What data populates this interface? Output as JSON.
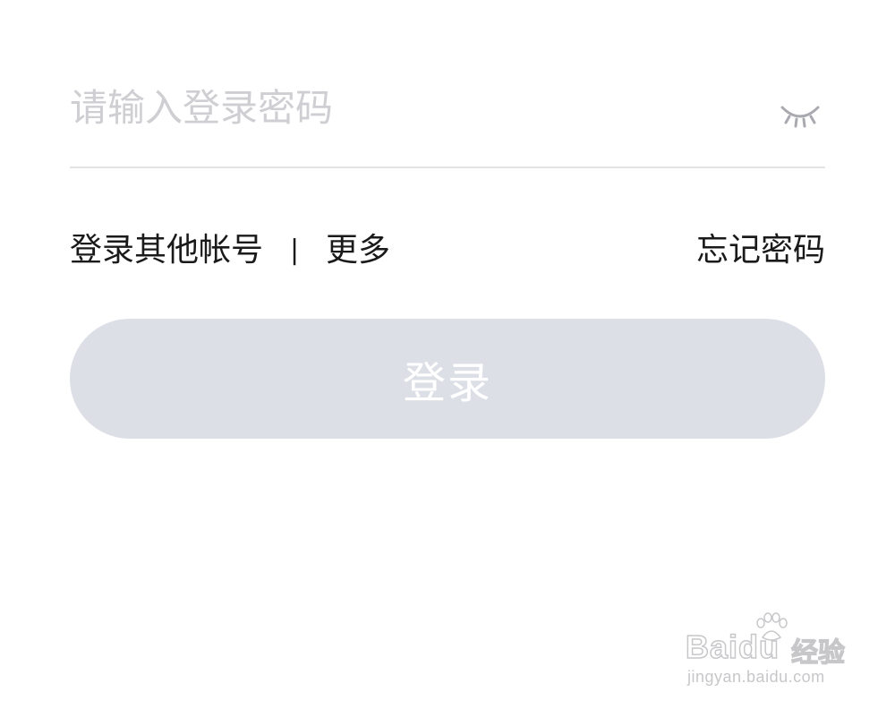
{
  "password": {
    "placeholder": "请输入登录密码",
    "value": "",
    "toggle_icon": "eye-closed-icon"
  },
  "links": {
    "other_account": "登录其他帐号",
    "separator": "|",
    "more": "更多",
    "forgot_password": "忘记密码"
  },
  "login_button": {
    "label": "登录",
    "background": "#dcdfe6",
    "text_color": "#ffffff"
  },
  "watermark": {
    "brand": "Baidu",
    "suffix": "经验",
    "url": "jingyan.baidu.com",
    "icon": "paw-icon"
  }
}
